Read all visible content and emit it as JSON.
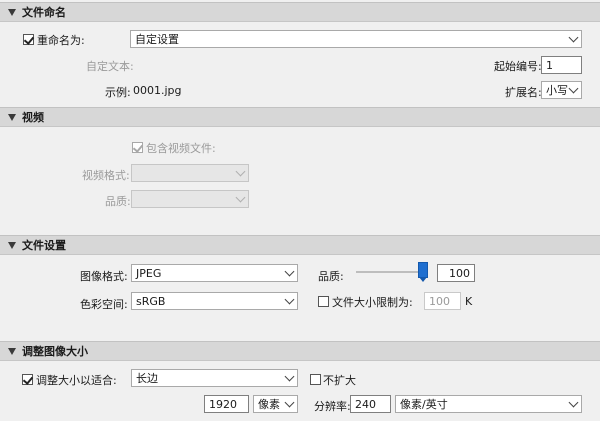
{
  "naming": {
    "title": "文件命名",
    "rename_label": "重命名为:",
    "rename_value": "自定设置",
    "custom_text_label": "自定文本:",
    "start_number_label": "起始编号:",
    "start_number_value": "1",
    "example_label": "示例:",
    "example_value": "0001.jpg",
    "extension_label": "扩展名:",
    "extension_value": "小写"
  },
  "video": {
    "title": "视频",
    "include_label": "包含视频文件:",
    "format_label": "视频格式:",
    "format_value": "",
    "quality_label": "品质:",
    "quality_value": ""
  },
  "file_settings": {
    "title": "文件设置",
    "format_label": "图像格式:",
    "format_value": "JPEG",
    "quality_label": "品质:",
    "quality_value": "100",
    "quality_fraction": 1.0,
    "colorspace_label": "色彩空间:",
    "colorspace_value": "sRGB",
    "limit_label": "文件大小限制为:",
    "limit_value": "100",
    "limit_unit": "K"
  },
  "resize": {
    "title": "调整图像大小",
    "fit_label": "调整大小以适合:",
    "fit_value": "长边",
    "no_enlarge_label": "不扩大",
    "size_value": "1920",
    "size_unit": "像素",
    "resolution_label": "分辨率:",
    "resolution_value": "240",
    "resolution_unit": "像素/英寸"
  }
}
